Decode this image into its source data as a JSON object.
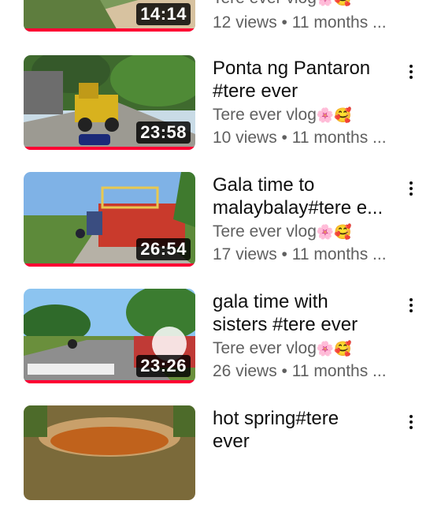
{
  "videos": [
    {
      "title_line1": "",
      "title_line2": "",
      "channel": "Tere ever vlog",
      "channel_emoji": "🌸🥰",
      "meta": "12 views • 11 months ...",
      "duration": "14:14",
      "watched_fraction": 1.0
    },
    {
      "title_line1": "Ponta ng Pantaron",
      "title_line2": "#tere ever",
      "channel": "Tere ever vlog",
      "channel_emoji": "🌸🥰",
      "meta": "10 views • 11 months ...",
      "duration": "23:58",
      "watched_fraction": 1.0
    },
    {
      "title_line1": "Gala time to",
      "title_line2": "malaybalay#tere e...",
      "channel": "Tere ever vlog",
      "channel_emoji": "🌸🥰",
      "meta": "17 views • 11 months ...",
      "duration": "26:54",
      "watched_fraction": 1.0
    },
    {
      "title_line1": "gala time with",
      "title_line2": "sisters #tere ever",
      "channel": "Tere ever vlog",
      "channel_emoji": "🌸🥰",
      "meta": "26 views • 11 months ...",
      "duration": "23:26",
      "watched_fraction": 1.0
    },
    {
      "title_line1": "hot spring#tere",
      "title_line2": "ever",
      "channel": "",
      "channel_emoji": "",
      "meta": "",
      "duration": "",
      "watched_fraction": 0
    }
  ],
  "colors": {
    "progress": "#ff0033",
    "meta_text": "#606060",
    "title_text": "#0f0f0f"
  },
  "icons": {
    "menu": "more-vert-icon"
  }
}
